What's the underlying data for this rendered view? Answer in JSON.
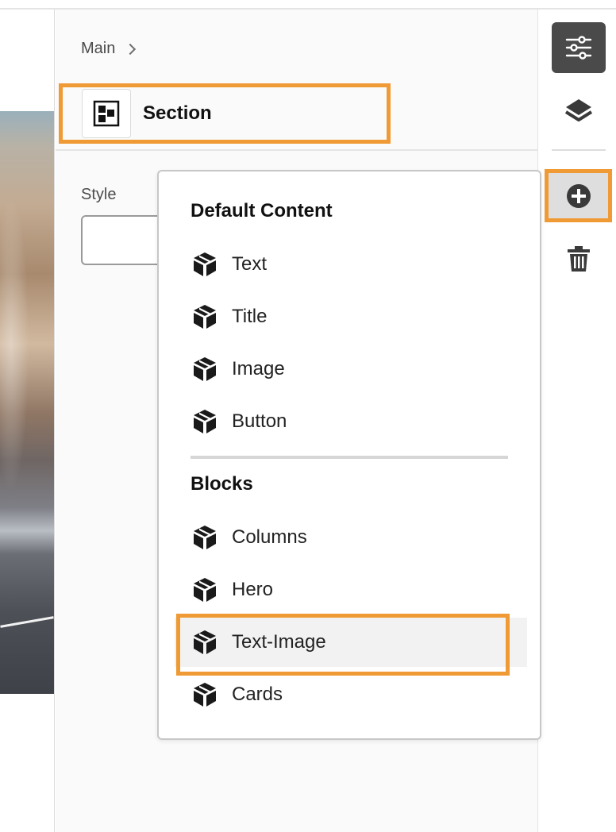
{
  "breadcrumb": {
    "root": "Main"
  },
  "section": {
    "title": "Section"
  },
  "properties": {
    "style_label": "Style",
    "style_value": ""
  },
  "toolbar": {
    "properties_icon": "sliders-icon",
    "layers_icon": "layers-icon",
    "add_icon": "add-circle-icon",
    "delete_icon": "trash-icon"
  },
  "add_menu": {
    "default_heading": "Default Content",
    "default_items": [
      {
        "label": "Text",
        "icon": "cube-icon"
      },
      {
        "label": "Title",
        "icon": "cube-icon"
      },
      {
        "label": "Image",
        "icon": "cube-icon"
      },
      {
        "label": "Button",
        "icon": "cube-icon"
      }
    ],
    "blocks_heading": "Blocks",
    "block_items": [
      {
        "label": "Columns",
        "icon": "cube-icon"
      },
      {
        "label": "Hero",
        "icon": "cube-icon"
      },
      {
        "label": "Text-Image",
        "icon": "cube-icon",
        "selected": true
      },
      {
        "label": "Cards",
        "icon": "cube-icon"
      }
    ]
  },
  "colors": {
    "highlight": "#ef9a34",
    "toolbar_active": "#4a4a4a"
  }
}
